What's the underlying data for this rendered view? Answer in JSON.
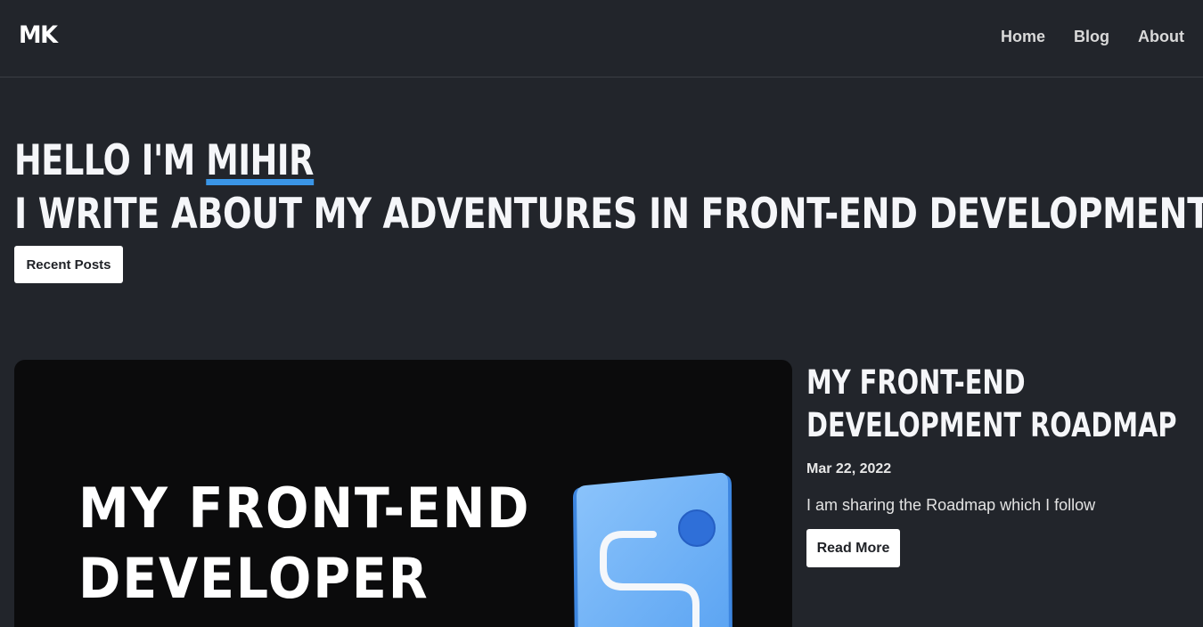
{
  "nav": {
    "logo": "MK",
    "links": [
      "Home",
      "Blog",
      "About"
    ]
  },
  "hero": {
    "greeting_prefix": "HELLO I'M ",
    "name": "MIHIR",
    "tagline": "I WRITE ABOUT MY ADVENTURES IN FRONT-END DEVELOPMENT",
    "button_label": "Recent Posts",
    "accent_color": "#3a95e6"
  },
  "post": {
    "cover_text": [
      "MY FRONT-END",
      "DEVELOPER"
    ],
    "cover_icon": "roadmap-path-icon",
    "title_lines": [
      "MY FRONT-END",
      "DEVELOPMENT ROADMAP"
    ],
    "date": "Mar 22, 2022",
    "excerpt": "I am sharing the Roadmap which I follow",
    "button_label": "Read More"
  }
}
